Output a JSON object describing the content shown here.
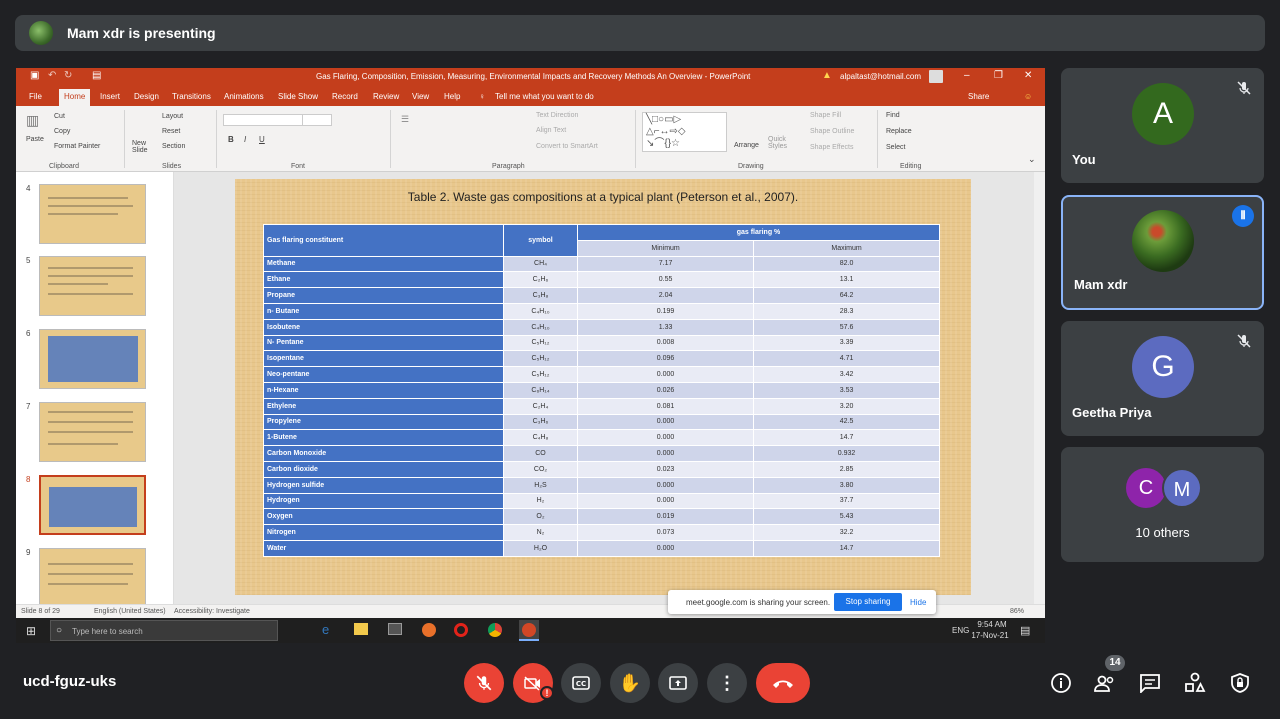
{
  "presenting": {
    "label": "Mam xdr is presenting"
  },
  "ppt": {
    "window_title": "Gas Flaring, Composition, Emission, Measuring, Environmental Impacts and Recovery Methods An Overview  -  PowerPoint",
    "account": "alpaltast@hotmail.com",
    "menu": [
      "File",
      "Home",
      "Insert",
      "Design",
      "Transitions",
      "Animations",
      "Slide Show",
      "Record",
      "Review",
      "View",
      "Help"
    ],
    "tell_me": "Tell me what you want to do",
    "share": "Share",
    "ribbon": {
      "cut": "Cut",
      "copy": "Copy",
      "format_painter": "Format Painter",
      "paste": "Paste",
      "new_slide": "New Slide",
      "layout": "Layout",
      "reset": "Reset",
      "section": "Section",
      "text_direction": "Text Direction",
      "align_text": "Align Text",
      "convert_smartart": "Convert to SmartArt",
      "arrange": "Arrange",
      "quick_styles": "Quick Styles",
      "shape_fill": "Shape Fill",
      "shape_outline": "Shape Outline",
      "shape_effects": "Shape Effects",
      "find": "Find",
      "replace": "Replace",
      "select": "Select",
      "groups": [
        "Clipboard",
        "Slides",
        "Font",
        "Paragraph",
        "Drawing",
        "Editing"
      ]
    },
    "thumb_numbers": [
      "4",
      "5",
      "6",
      "7",
      "8",
      "9"
    ],
    "slide": {
      "title": "Table 2. Waste gas compositions at a typical plant (Peterson et al., 2007).",
      "headers": {
        "constituent": "Gas flaring constituent",
        "symbol": "symbol",
        "gas": "gas flaring %",
        "min": "Minimum",
        "max": "Maximum"
      },
      "rows": [
        {
          "name": "Methane",
          "symbol": "CH₄",
          "min": "7.17",
          "max": "82.0"
        },
        {
          "name": "Ethane",
          "symbol": "C₂H₆",
          "min": "0.55",
          "max": "13.1"
        },
        {
          "name": "Propane",
          "symbol": "C₃H₈",
          "min": "2.04",
          "max": "64.2"
        },
        {
          "name": "n- Butane",
          "symbol": "C₄H₁₀",
          "min": "0.199",
          "max": "28.3"
        },
        {
          "name": "Isobutene",
          "symbol": "C₄H₁₀",
          "min": "1.33",
          "max": "57.6"
        },
        {
          "name": "N- Pentane",
          "symbol": "C₅H₁₂",
          "min": "0.008",
          "max": "3.39"
        },
        {
          "name": "Isopentane",
          "symbol": "C₅H₁₂",
          "min": "0.096",
          "max": "4.71"
        },
        {
          "name": "Neo-pentane",
          "symbol": "C₅H₁₂",
          "min": "0.000",
          "max": "3.42"
        },
        {
          "name": "n-Hexane",
          "symbol": "C₆H₁₄",
          "min": "0.026",
          "max": "3.53"
        },
        {
          "name": "Ethylene",
          "symbol": "C₂H₄",
          "min": "0.081",
          "max": "3.20"
        },
        {
          "name": "Propylene",
          "symbol": "C₃H₆",
          "min": "0.000",
          "max": "42.5"
        },
        {
          "name": "1-Butene",
          "symbol": "C₄H₈",
          "min": "0.000",
          "max": "14.7"
        },
        {
          "name": "Carbon Monoxide",
          "symbol": "CO",
          "min": "0.000",
          "max": "0.932"
        },
        {
          "name": "Carbon dioxide",
          "symbol": "CO₂",
          "min": "0.023",
          "max": "2.85"
        },
        {
          "name": "Hydrogen sulfide",
          "symbol": "H₂S",
          "min": "0.000",
          "max": "3.80"
        },
        {
          "name": "Hydrogen",
          "symbol": "H₂",
          "min": "0.000",
          "max": "37.7"
        },
        {
          "name": "Oxygen",
          "symbol": "O₂",
          "min": "0.019",
          "max": "5.43"
        },
        {
          "name": "Nitrogen",
          "symbol": "N₂",
          "min": "0.073",
          "max": "32.2"
        },
        {
          "name": "Water",
          "symbol": "H₂O",
          "min": "0.000",
          "max": "14.7"
        }
      ]
    },
    "status": {
      "slide": "Slide 8 of 29",
      "language": "English (United States)",
      "accessibility": "Accessibility: Investigate",
      "zoom": "86%"
    },
    "taskbar": {
      "search": "Type here to search",
      "lang": "ENG",
      "time": "9:54 AM",
      "date": "17-Nov-21"
    },
    "share_popup": {
      "text": "meet.google.com is sharing your screen.",
      "stop": "Stop sharing",
      "hide": "Hide"
    }
  },
  "participants": [
    {
      "name": "You",
      "initial": "A",
      "color": "#33691e"
    },
    {
      "name": "Mam xdr"
    },
    {
      "name": "Geetha Priya",
      "initial": "G",
      "color": "#5c6bc0"
    },
    {
      "name": "10 others",
      "initials": [
        "C",
        "M"
      ],
      "colors": [
        "#8e24aa",
        "#5c6bc0"
      ]
    }
  ],
  "meeting": {
    "code": "ucd-fguz-uks",
    "people_count": "14"
  }
}
